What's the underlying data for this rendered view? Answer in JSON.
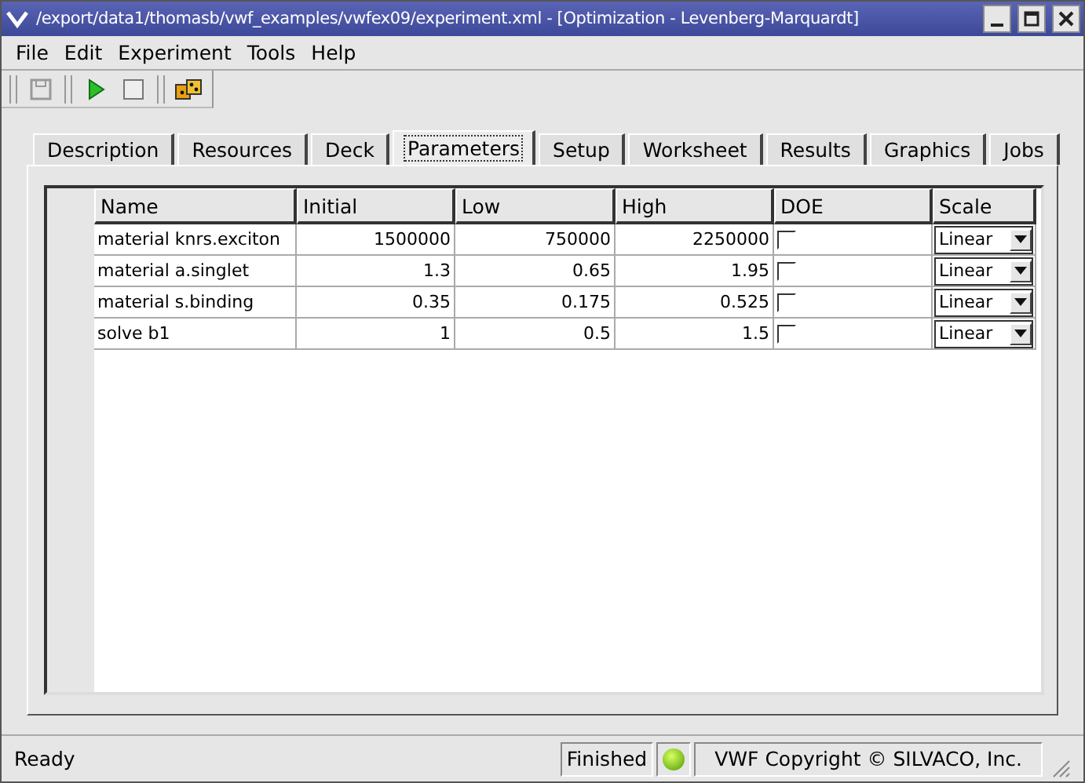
{
  "window": {
    "title": "/export/data1/thomasb/vwf_examples/vwfex09/experiment.xml - [Optimization - Levenberg-Marquardt]"
  },
  "menu": [
    "File",
    "Edit",
    "Experiment",
    "Tools",
    "Help"
  ],
  "tabs": [
    {
      "label": "Description",
      "selected": false
    },
    {
      "label": "Resources",
      "selected": false
    },
    {
      "label": "Deck",
      "selected": false
    },
    {
      "label": "Parameters",
      "selected": true
    },
    {
      "label": "Setup",
      "selected": false
    },
    {
      "label": "Worksheet",
      "selected": false
    },
    {
      "label": "Results",
      "selected": false
    },
    {
      "label": "Graphics",
      "selected": false
    },
    {
      "label": "Jobs",
      "selected": false
    }
  ],
  "table": {
    "columns": [
      "Name",
      "Initial",
      "Low",
      "High",
      "DOE",
      "Scale"
    ],
    "rows": [
      {
        "name": "material knrs.exciton",
        "initial": "1500000",
        "low": "750000",
        "high": "2250000",
        "doe": false,
        "scale": "Linear"
      },
      {
        "name": "material a.singlet",
        "initial": "1.3",
        "low": "0.65",
        "high": "1.95",
        "doe": false,
        "scale": "Linear"
      },
      {
        "name": "material s.binding",
        "initial": "0.35",
        "low": "0.175",
        "high": "0.525",
        "doe": false,
        "scale": "Linear"
      },
      {
        "name": "solve b1",
        "initial": "1",
        "low": "0.5",
        "high": "1.5",
        "doe": false,
        "scale": "Linear"
      }
    ]
  },
  "status_bar": {
    "message": "Ready",
    "state": "Finished",
    "light_on": true,
    "copyright": "VWF Copyright ©  SILVACO, Inc."
  }
}
